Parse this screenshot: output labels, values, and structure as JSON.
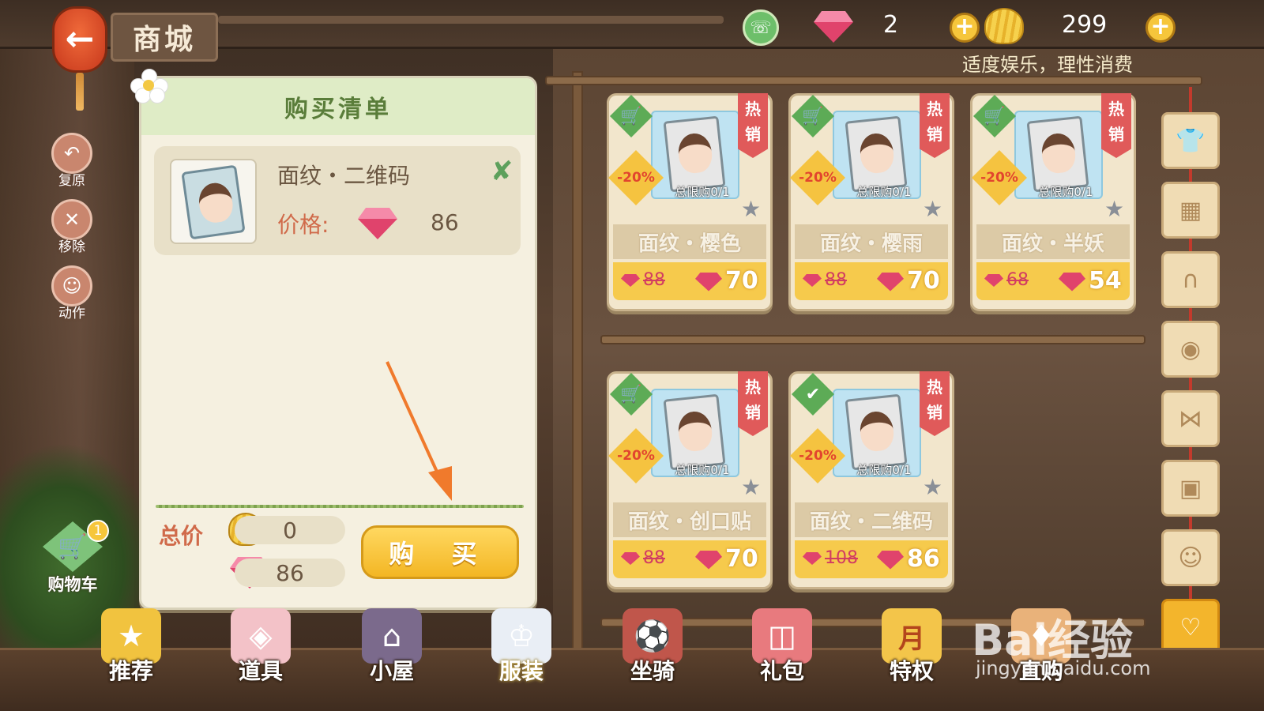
{
  "header": {
    "back_icon": "back-arrow-icon",
    "title": "商城",
    "gem_count": "2",
    "shell_count": "299",
    "notice": "适度娱乐，理性消费"
  },
  "side_actions": [
    {
      "label": "复原",
      "icon": "restore-icon"
    },
    {
      "label": "移除",
      "icon": "remove-icon"
    },
    {
      "label": "动作",
      "icon": "action-icon"
    }
  ],
  "cart": {
    "label": "购物车",
    "badge": "1"
  },
  "purchase_list": {
    "title": "购买清单",
    "item": {
      "name": "面纹・二维码",
      "price_label": "价格:",
      "price": "86"
    },
    "total_label": "总价",
    "total_shell": "0",
    "total_gem": "86",
    "buy_label": "购 买"
  },
  "products": [
    {
      "hot": "热销",
      "discount": "-20%",
      "limit": "总限购0/1",
      "name": "面纹・樱色",
      "old_price": "88",
      "price": "70",
      "status": "cart"
    },
    {
      "hot": "热销",
      "discount": "-20%",
      "limit": "总限购0/1",
      "name": "面纹・樱雨",
      "old_price": "88",
      "price": "70",
      "status": "cart"
    },
    {
      "hot": "热销",
      "discount": "-20%",
      "limit": "总限购0/1",
      "name": "面纹・半妖",
      "old_price": "68",
      "price": "54",
      "status": "cart"
    },
    {
      "hot": "热销",
      "discount": "-20%",
      "limit": "总限购0/1",
      "name": "面纹・创口贴",
      "old_price": "88",
      "price": "70",
      "status": "cart"
    },
    {
      "hot": "热销",
      "discount": "-20%",
      "limit": "总限购0/1",
      "name": "面纹・二维码",
      "old_price": "108",
      "price": "86",
      "status": "selected"
    }
  ],
  "categories": [
    {
      "icon": "shirt-icon"
    },
    {
      "icon": "shorts-icon"
    },
    {
      "icon": "sandals-icon"
    },
    {
      "icon": "hat-icon"
    },
    {
      "icon": "bow-icon"
    },
    {
      "icon": "backpack-icon"
    },
    {
      "icon": "hair-icon"
    },
    {
      "icon": "face-icon",
      "active": true
    }
  ],
  "bottom_nav": [
    {
      "label": "推荐",
      "icon": "star-icon"
    },
    {
      "label": "道具",
      "icon": "fox-mask-icon"
    },
    {
      "label": "小屋",
      "icon": "house-icon"
    },
    {
      "label": "服装",
      "icon": "sailor-uniform-icon",
      "active": true
    },
    {
      "label": "坐骑",
      "icon": "bicycle-icon"
    },
    {
      "label": "礼包",
      "icon": "gift-icon"
    },
    {
      "label": "特权",
      "icon": "monthly-card-icon",
      "badge": "月"
    },
    {
      "label": "直购",
      "icon": "direct-buy-icon"
    }
  ],
  "watermark": {
    "text": "Bai经验",
    "sub": "jingyan.baidu.com"
  },
  "colors": {
    "accent": "#f3b624",
    "hot": "#e05a5a",
    "gem": "#e0436c",
    "green": "#5dab56"
  }
}
